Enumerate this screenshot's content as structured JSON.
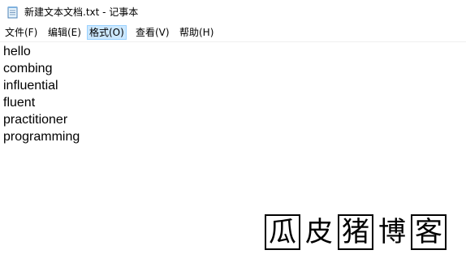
{
  "window": {
    "title": "新建文本文档.txt - 记事本",
    "icon": "notepad-icon"
  },
  "menu": {
    "items": [
      {
        "label": "文件(F)"
      },
      {
        "label": "编辑(E)"
      },
      {
        "label": "格式(O)",
        "active": true
      },
      {
        "label": "查看(V)"
      },
      {
        "label": "帮助(H)"
      }
    ]
  },
  "editor": {
    "lines": [
      "hello",
      "combing",
      "influential",
      "fluent",
      "practitioner",
      "programming"
    ]
  },
  "watermark": {
    "text": "瓜皮猪博客",
    "chars": [
      "瓜",
      "皮",
      "猪",
      "博",
      "客"
    ]
  }
}
